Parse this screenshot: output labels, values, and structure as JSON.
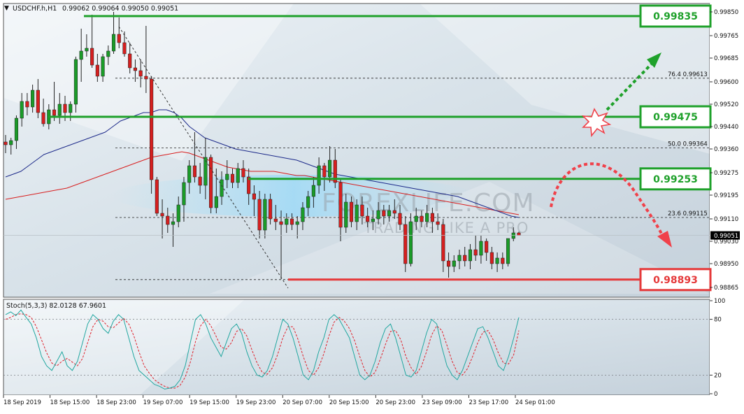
{
  "header": {
    "symbol": "USDCHF.h,H1",
    "ohlc": "0.99062 0.99064 0.99050 0.99051",
    "stoch_label": "Stoch(5,3,3) 82.0128 67.9601"
  },
  "watermark": {
    "brand": "FOREXLIFE.COM",
    "tagline": "TRADING LIKE A PRO"
  },
  "levels": [
    {
      "price": 0.99835,
      "label": "0.99835",
      "kind": "resistance",
      "color": "#1fa12b"
    },
    {
      "price": 0.99475,
      "label": "0.99475",
      "kind": "resistance",
      "color": "#1fa12b"
    },
    {
      "price": 0.99253,
      "label": "0.99253",
      "kind": "resistance",
      "color": "#1fa12b"
    },
    {
      "price": 0.98893,
      "label": "0.98893",
      "kind": "support",
      "color": "#e5393a"
    }
  ],
  "fib_levels": [
    {
      "price": 0.99613,
      "label": "76.4",
      "value": "0.99613"
    },
    {
      "price": 0.99364,
      "label": "50.0",
      "value": "0.99364"
    },
    {
      "price": 0.99115,
      "label": "23.6",
      "value": "0.99115"
    }
  ],
  "current_price": "0.99051",
  "colors": {
    "bull": "#1a9b28",
    "bear": "#d61f1f",
    "ma_fast": "#1d2a8a",
    "ma_slow": "#d81e1e",
    "stoch_main": "#22a7a0",
    "stoch_signal": "#e0202a",
    "axis_bg": "#ffffff"
  },
  "chart_data": {
    "type": "candlestick",
    "y_axis": {
      "ylim": [
        0.9883,
        0.9988
      ],
      "ticks": [
        "0.99850",
        "0.99765",
        "0.99685",
        "0.99600",
        "0.99520",
        "0.99440",
        "0.99360",
        "0.99275",
        "0.99195",
        "0.99110",
        "0.99030",
        "0.98950",
        "0.98865"
      ]
    },
    "x_axis": {
      "ticks": [
        "18 Sep 2019",
        "18 Sep 15:00",
        "18 Sep 23:00",
        "19 Sep 07:00",
        "19 Sep 15:00",
        "19 Sep 23:00",
        "20 Sep 07:00",
        "20 Sep 15:00",
        "20 Sep 23:00",
        "23 Sep 09:00",
        "23 Sep 17:00",
        "24 Sep 01:00"
      ]
    },
    "candles": [
      [
        0.99385,
        0.9941,
        0.99345,
        0.99375
      ],
      [
        0.99375,
        0.994,
        0.9934,
        0.9939
      ],
      [
        0.9939,
        0.9948,
        0.9936,
        0.9947
      ],
      [
        0.9947,
        0.9956,
        0.9944,
        0.9953
      ],
      [
        0.9953,
        0.9956,
        0.9948,
        0.9951
      ],
      [
        0.9951,
        0.9959,
        0.9949,
        0.9957
      ],
      [
        0.9957,
        0.9961,
        0.9947,
        0.9949
      ],
      [
        0.9949,
        0.9954,
        0.9944,
        0.9945
      ],
      [
        0.9945,
        0.9952,
        0.9943,
        0.995
      ],
      [
        0.995,
        0.996,
        0.9946,
        0.9948
      ],
      [
        0.9948,
        0.9956,
        0.9945,
        0.9952
      ],
      [
        0.9952,
        0.9955,
        0.9946,
        0.9949
      ],
      [
        0.9949,
        0.9953,
        0.9946,
        0.9952
      ],
      [
        0.9952,
        0.9969,
        0.9949,
        0.9968
      ],
      [
        0.9968,
        0.9979,
        0.996,
        0.9971
      ],
      [
        0.9971,
        0.9977,
        0.9969,
        0.9972
      ],
      [
        0.9972,
        0.9984,
        0.9965,
        0.9966
      ],
      [
        0.9966,
        0.997,
        0.996,
        0.9962
      ],
      [
        0.9962,
        0.997,
        0.996,
        0.9969
      ],
      [
        0.9969,
        0.9973,
        0.9966,
        0.9971
      ],
      [
        0.9971,
        0.9985,
        0.997,
        0.9977
      ],
      [
        0.9977,
        0.9983,
        0.9972,
        0.9974
      ],
      [
        0.9974,
        0.9978,
        0.9969,
        0.997
      ],
      [
        0.997,
        0.9974,
        0.9963,
        0.9965
      ],
      [
        0.9965,
        0.9968,
        0.996,
        0.9964
      ],
      [
        0.9964,
        0.9968,
        0.9958,
        0.9962
      ],
      [
        0.9962,
        0.998,
        0.9956,
        0.9961
      ],
      [
        0.9961,
        0.9962,
        0.992,
        0.9925
      ],
      [
        0.9925,
        0.9926,
        0.9912,
        0.9913
      ],
      [
        0.9913,
        0.9918,
        0.9904,
        0.9912
      ],
      [
        0.9912,
        0.9915,
        0.9906,
        0.9909
      ],
      [
        0.9909,
        0.9913,
        0.9901,
        0.991
      ],
      [
        0.991,
        0.9919,
        0.9908,
        0.9916
      ],
      [
        0.9916,
        0.9926,
        0.991,
        0.9924
      ],
      [
        0.9924,
        0.9932,
        0.992,
        0.993
      ],
      [
        0.993,
        0.9942,
        0.9924,
        0.9926
      ],
      [
        0.9926,
        0.9931,
        0.992,
        0.9923
      ],
      [
        0.9923,
        0.994,
        0.9918,
        0.9933
      ],
      [
        0.9933,
        0.9934,
        0.9913,
        0.9915
      ],
      [
        0.9915,
        0.9929,
        0.9913,
        0.9919
      ],
      [
        0.9919,
        0.9928,
        0.9916,
        0.9925
      ],
      [
        0.9925,
        0.9932,
        0.9922,
        0.9927
      ],
      [
        0.9927,
        0.9929,
        0.9922,
        0.9924
      ],
      [
        0.9924,
        0.9931,
        0.9922,
        0.9929
      ],
      [
        0.9929,
        0.9932,
        0.9924,
        0.9926
      ],
      [
        0.9926,
        0.9929,
        0.9916,
        0.992
      ],
      [
        0.992,
        0.9923,
        0.9912,
        0.9918
      ],
      [
        0.9918,
        0.9921,
        0.9904,
        0.9907
      ],
      [
        0.9907,
        0.992,
        0.9904,
        0.9918
      ],
      [
        0.9918,
        0.992,
        0.9909,
        0.9911
      ],
      [
        0.9911,
        0.9916,
        0.9907,
        0.991
      ],
      [
        0.991,
        0.9914,
        0.98895,
        0.9909
      ],
      [
        0.9909,
        0.9913,
        0.9906,
        0.9911
      ],
      [
        0.9911,
        0.9913,
        0.9907,
        0.9909
      ],
      [
        0.9909,
        0.9912,
        0.9904,
        0.991
      ],
      [
        0.991,
        0.9917,
        0.9907,
        0.9915
      ],
      [
        0.9915,
        0.9921,
        0.9912,
        0.9919
      ],
      [
        0.9919,
        0.9926,
        0.9915,
        0.9923
      ],
      [
        0.9923,
        0.9933,
        0.992,
        0.993
      ],
      [
        0.993,
        0.9931,
        0.9921,
        0.9926
      ],
      [
        0.9926,
        0.9937,
        0.9924,
        0.9932
      ],
      [
        0.9932,
        0.9936,
        0.9922,
        0.9924
      ],
      [
        0.9924,
        0.9925,
        0.9903,
        0.9908
      ],
      [
        0.9908,
        0.992,
        0.9906,
        0.9917
      ],
      [
        0.9917,
        0.9919,
        0.9908,
        0.991
      ],
      [
        0.991,
        0.9918,
        0.9907,
        0.9916
      ],
      [
        0.9916,
        0.9919,
        0.9909,
        0.9912
      ],
      [
        0.9912,
        0.9915,
        0.9908,
        0.991
      ],
      [
        0.991,
        0.9914,
        0.9907,
        0.9911
      ],
      [
        0.9911,
        0.9917,
        0.9909,
        0.9914
      ],
      [
        0.9914,
        0.9916,
        0.9909,
        0.9912
      ],
      [
        0.9912,
        0.9916,
        0.991,
        0.9914
      ],
      [
        0.9914,
        0.9918,
        0.9911,
        0.9913
      ],
      [
        0.9913,
        0.9916,
        0.9907,
        0.9909
      ],
      [
        0.9909,
        0.9912,
        0.9892,
        0.9895
      ],
      [
        0.9895,
        0.9913,
        0.9894,
        0.991
      ],
      [
        0.991,
        0.9915,
        0.9907,
        0.9912
      ],
      [
        0.9912,
        0.9914,
        0.9908,
        0.991
      ],
      [
        0.991,
        0.9916,
        0.9908,
        0.9913
      ],
      [
        0.9913,
        0.9915,
        0.9906,
        0.991
      ],
      [
        0.991,
        0.9913,
        0.9907,
        0.9909
      ],
      [
        0.9909,
        0.9911,
        0.9892,
        0.9896
      ],
      [
        0.9896,
        0.9899,
        0.989,
        0.9894
      ],
      [
        0.9894,
        0.9898,
        0.9892,
        0.9896
      ],
      [
        0.9896,
        0.99,
        0.9893,
        0.9898
      ],
      [
        0.9898,
        0.9901,
        0.9894,
        0.9896
      ],
      [
        0.9896,
        0.9902,
        0.9893,
        0.99
      ],
      [
        0.99,
        0.9905,
        0.9896,
        0.9898
      ],
      [
        0.9898,
        0.9905,
        0.9895,
        0.9903
      ],
      [
        0.9903,
        0.9904,
        0.9896,
        0.9899
      ],
      [
        0.9899,
        0.9901,
        0.9893,
        0.9895
      ],
      [
        0.9895,
        0.9899,
        0.9892,
        0.9897
      ],
      [
        0.9897,
        0.9899,
        0.9893,
        0.9895
      ],
      [
        0.9895,
        0.9904,
        0.9894,
        0.9904
      ],
      [
        0.9904,
        0.9908,
        0.9903,
        0.9906
      ],
      [
        0.9906,
        0.99064,
        0.9905,
        0.99051
      ]
    ],
    "ma_fast": [
      0.9926,
      0.9927,
      0.9928,
      0.993,
      0.9932,
      0.9934,
      0.9935,
      0.9936,
      0.9937,
      0.9938,
      0.9939,
      0.994,
      0.9941,
      0.9942,
      0.9944,
      0.9946,
      0.9947,
      0.9948,
      0.9949,
      0.9949,
      0.995,
      0.995,
      0.9949,
      0.9947,
      0.9944,
      0.9942,
      0.994,
      0.9939,
      0.9938,
      0.9937,
      0.9936,
      0.99355,
      0.9935,
      0.99345,
      0.9934,
      0.99335,
      0.9933,
      0.99325,
      0.9932,
      0.9931,
      0.993,
      0.9929,
      0.9928,
      0.9927,
      0.99265,
      0.9926,
      0.99255,
      0.9925,
      0.99245,
      0.9924,
      0.99235,
      0.9923,
      0.99225,
      0.9922,
      0.99215,
      0.9921,
      0.99205,
      0.992,
      0.99195,
      0.9919,
      0.9918,
      0.9917,
      0.9916,
      0.9915,
      0.9914,
      0.9913,
      0.9912,
      0.99115
    ],
    "ma_slow": [
      0.9918,
      0.99185,
      0.9919,
      0.99195,
      0.992,
      0.99205,
      0.9921,
      0.99215,
      0.9922,
      0.9923,
      0.9924,
      0.9925,
      0.9926,
      0.9927,
      0.9928,
      0.9929,
      0.993,
      0.9931,
      0.9932,
      0.9933,
      0.99335,
      0.9934,
      0.99345,
      0.9935,
      0.99345,
      0.99335,
      0.99325,
      0.99315,
      0.99305,
      0.99295,
      0.9929,
      0.99285,
      0.9928,
      0.9928,
      0.9928,
      0.9928,
      0.99275,
      0.9927,
      0.99265,
      0.99265,
      0.9926,
      0.99255,
      0.9925,
      0.99245,
      0.9924,
      0.99235,
      0.9923,
      0.99225,
      0.9922,
      0.99215,
      0.9921,
      0.99205,
      0.992,
      0.99195,
      0.9919,
      0.99185,
      0.9918,
      0.99175,
      0.9917,
      0.99165,
      0.9916,
      0.99155,
      0.9915,
      0.99145,
      0.9914,
      0.99135,
      0.9913,
      0.99125
    ],
    "stoch": {
      "ylim": [
        0,
        100
      ],
      "ticks": [
        "100",
        "80",
        "20",
        "0"
      ],
      "main": [
        85,
        88,
        84,
        90,
        82,
        75,
        60,
        40,
        30,
        25,
        35,
        45,
        30,
        25,
        35,
        55,
        75,
        85,
        80,
        70,
        65,
        78,
        85,
        80,
        60,
        40,
        25,
        20,
        15,
        10,
        8,
        5,
        6,
        8,
        15,
        30,
        55,
        80,
        85,
        75,
        60,
        50,
        40,
        55,
        70,
        75,
        65,
        45,
        30,
        20,
        18,
        25,
        40,
        60,
        80,
        75,
        60,
        40,
        20,
        15,
        25,
        45,
        60,
        80,
        85,
        80,
        70,
        60,
        40,
        20,
        15,
        20,
        35,
        55,
        70,
        75,
        60,
        40,
        20,
        18,
        25,
        45,
        65,
        80,
        75,
        50,
        30,
        20,
        15,
        25,
        40,
        55,
        70,
        72,
        60,
        45,
        30,
        25,
        40,
        60,
        82
      ],
      "signal": [
        80,
        82,
        85,
        86,
        85,
        82,
        72,
        58,
        44,
        33,
        30,
        35,
        38,
        34,
        30,
        38,
        55,
        72,
        80,
        78,
        72,
        71,
        76,
        81,
        75,
        62,
        45,
        30,
        22,
        15,
        11,
        8,
        6,
        6,
        9,
        18,
        34,
        56,
        73,
        80,
        73,
        62,
        50,
        48,
        55,
        67,
        70,
        62,
        47,
        33,
        23,
        21,
        28,
        42,
        60,
        72,
        72,
        58,
        40,
        25,
        20,
        28,
        43,
        62,
        77,
        82,
        78,
        70,
        57,
        40,
        25,
        18,
        23,
        37,
        53,
        67,
        68,
        58,
        40,
        28,
        21,
        29,
        45,
        63,
        73,
        68,
        52,
        35,
        23,
        20,
        27,
        40,
        55,
        66,
        68,
        58,
        44,
        33,
        32,
        42,
        68
      ]
    }
  }
}
